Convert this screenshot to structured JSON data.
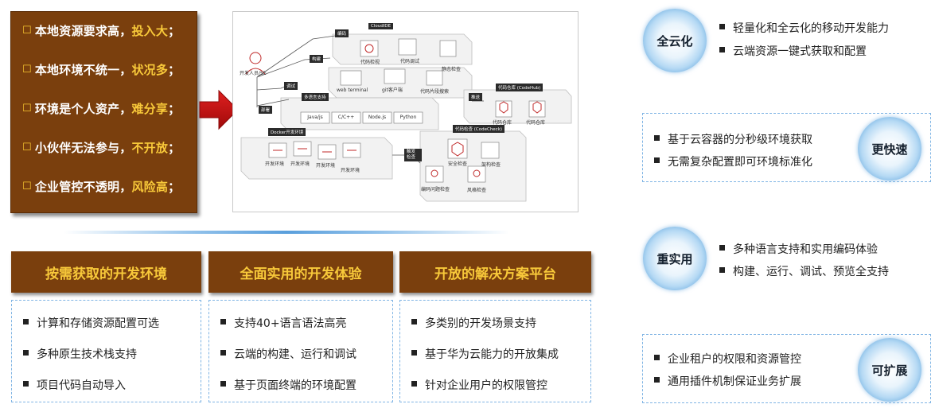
{
  "problems": [
    {
      "text": "本地资源要求高，",
      "highlight": "投入大",
      "end": "；"
    },
    {
      "text": "本地环境不统一，",
      "highlight": "状况多",
      "end": "；"
    },
    {
      "text": "环境是个人资产，",
      "highlight": "难分享",
      "end": "；"
    },
    {
      "text": "小伙伴无法参与，",
      "highlight": "不开放",
      "end": "；"
    },
    {
      "text": "企业管控不透明，",
      "highlight": "风险高",
      "end": "；"
    }
  ],
  "diagram": {
    "developer": "开发人员/SE",
    "flows": [
      "编码",
      "构建",
      "调试",
      "部署"
    ],
    "cloudide": "CloudIDE",
    "cloudide_items": [
      "代码检视",
      "代码调试",
      "静态检查",
      "web terminal",
      "git客户端",
      "代码片段搜索"
    ],
    "lang_title": "多语言支持",
    "langs": [
      "Java/js",
      "C/C++",
      "Node.js",
      "Python"
    ],
    "docker_title": "Docker开发环境",
    "envs": [
      "开发环境",
      "开发环境",
      "开发环境",
      "开发环境"
    ],
    "push_label": "推送",
    "codehub": "代码仓库 (CodeHub)",
    "codehub_items": [
      "代码仓库",
      "代码仓库"
    ],
    "trigger_label": "触发检查",
    "codecheck": "代码检查 (CodeCheck)",
    "codecheck_items": [
      "安全检查",
      "架构检查",
      "编码问题检查",
      "风格检查"
    ]
  },
  "columns": [
    {
      "title": "按需获取的开发环境",
      "items": [
        "计算和存储资源配置可选",
        "多种原生技术栈支持",
        "项目代码自动导入"
      ]
    },
    {
      "title": "全面实用的开发体验",
      "items": [
        "支持40+语言语法高亮",
        "云端的构建、运行和调试",
        "基于页面终端的环境配置"
      ]
    },
    {
      "title": "开放的解决方案平台",
      "items": [
        "多类别的开发场景支持",
        "基于华为云能力的开放集成",
        "针对企业用户的权限管控"
      ]
    }
  ],
  "features": [
    {
      "badge": "全云化",
      "items": [
        "轻量化和全云化的移动开发能力",
        "云端资源一键式获取和配置"
      ]
    },
    {
      "badge": "更快速",
      "items": [
        "基于云容器的分秒级环境获取",
        "无需复杂配置即可环境标准化"
      ]
    },
    {
      "badge": "重实用",
      "items": [
        "多种语言支持和实用编码体验",
        "构建、运行、调试、预览全支持"
      ]
    },
    {
      "badge": "可扩展",
      "items": [
        "企业租户的权限和资源管控",
        "通用插件机制保证业务扩展"
      ]
    }
  ]
}
